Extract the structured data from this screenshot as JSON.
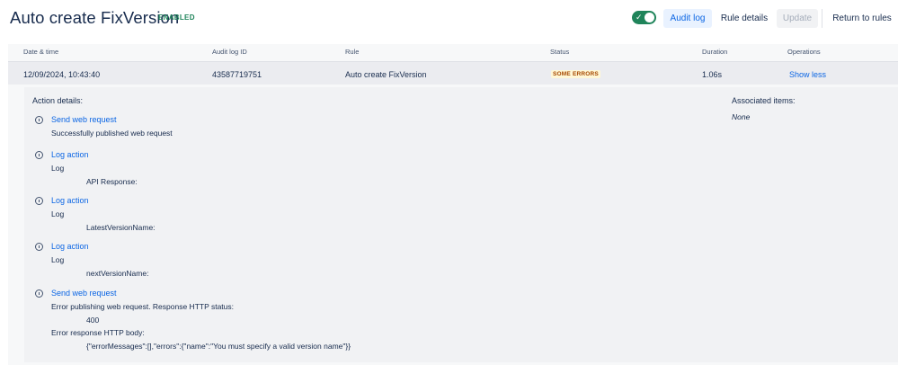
{
  "header": {
    "title": "Auto create FixVersion",
    "status_lozenge": "ENABLED",
    "toggle_checked": true,
    "buttons": {
      "audit_log": "Audit log",
      "rule_details": "Rule details",
      "update": "Update",
      "return": "Return to rules"
    }
  },
  "table": {
    "columns": [
      "Date & time",
      "Audit log ID",
      "Rule",
      "Status",
      "Duration",
      "Operations"
    ],
    "row": {
      "date": "12/09/2024, 10:43:40",
      "audit_id": "43587719751",
      "rule": "Auto create FixVersion",
      "status": "SOME ERRORS",
      "duration": "1.06s",
      "operation": "Show less"
    }
  },
  "details": {
    "action_details_label": "Action details:",
    "associated_label": "Associated items:",
    "associated_value": "None",
    "entries": [
      {
        "title": "Send web request",
        "lines": [
          "Successfully published web request"
        ]
      },
      {
        "title": "Log action",
        "lines": [
          "Log",
          "API Response:"
        ]
      },
      {
        "title": "Log action",
        "lines": [
          "Log",
          "LatestVersionName:"
        ]
      },
      {
        "title": "Log action",
        "lines": [
          "Log",
          "nextVersionName:"
        ]
      },
      {
        "title": "Send web request",
        "lines": [
          "Error publishing web request. Response HTTP status:",
          "400",
          "Error response HTTP body:",
          "{\"errorMessages\":[],\"errors\":{\"name\":\"You must specify a valid version name\"}}"
        ]
      }
    ]
  },
  "colors": {
    "accent": "#0c66e4",
    "enabled": "#1f845a",
    "warning_bg": "#fff7d6",
    "warning_text": "#a54800"
  }
}
